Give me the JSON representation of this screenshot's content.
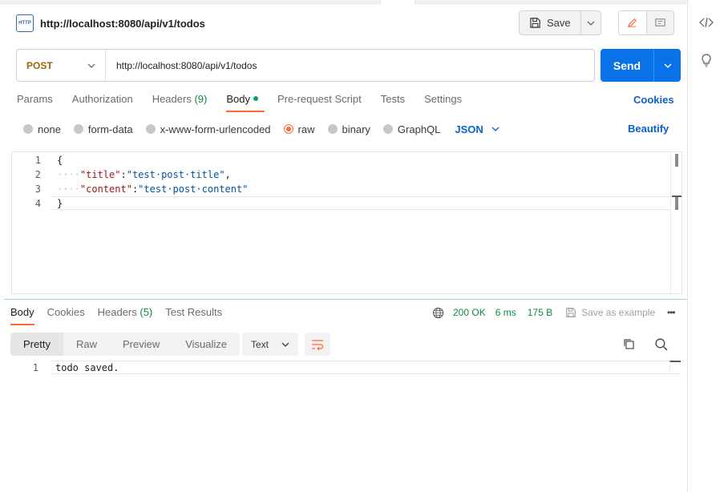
{
  "request": {
    "title": "http://localhost:8080/api/v1/todos",
    "method": "POST",
    "url": "http://localhost:8080/api/v1/todos",
    "save_label": "Save",
    "send_label": "Send"
  },
  "request_tabs": [
    {
      "label": "Params",
      "count": ""
    },
    {
      "label": "Authorization",
      "count": ""
    },
    {
      "label": "Headers",
      "count": "(9)"
    },
    {
      "label": "Body",
      "count": ""
    },
    {
      "label": "Pre-request Script",
      "count": ""
    },
    {
      "label": "Tests",
      "count": ""
    },
    {
      "label": "Settings",
      "count": ""
    }
  ],
  "cookies_link": "Cookies",
  "body_types": [
    "none",
    "form-data",
    "x-www-form-urlencoded",
    "raw",
    "binary",
    "GraphQL"
  ],
  "body_language": "JSON",
  "beautify_link": "Beautify",
  "request_body": {
    "line_numbers": [
      "1",
      "2",
      "3",
      "4"
    ],
    "open_brace": "{",
    "close_brace": "}",
    "indent": "····",
    "title_key": "\"title\"",
    "title_value": "\"test·post·title\"",
    "content_key": "\"content\"",
    "content_value": "\"test·post·content\"",
    "colon": ":",
    "comma": ","
  },
  "response_tabs": [
    {
      "label": "Body",
      "count": ""
    },
    {
      "label": "Cookies",
      "count": ""
    },
    {
      "label": "Headers",
      "count": "(5)"
    },
    {
      "label": "Test Results",
      "count": ""
    }
  ],
  "response_meta": {
    "status": "200 OK",
    "time": "6 ms",
    "size": "175 B",
    "save_example": "Save as example"
  },
  "view_modes": [
    "Pretty",
    "Raw",
    "Preview",
    "Visualize"
  ],
  "format": "Text",
  "response_body": {
    "line_numbers": [
      "1"
    ],
    "lines": [
      "todo saved."
    ]
  },
  "colors": {
    "accent": "#ff6c37",
    "primary": "#0a72e8",
    "success": "#0f8a3f",
    "method_post": "#a06508"
  }
}
